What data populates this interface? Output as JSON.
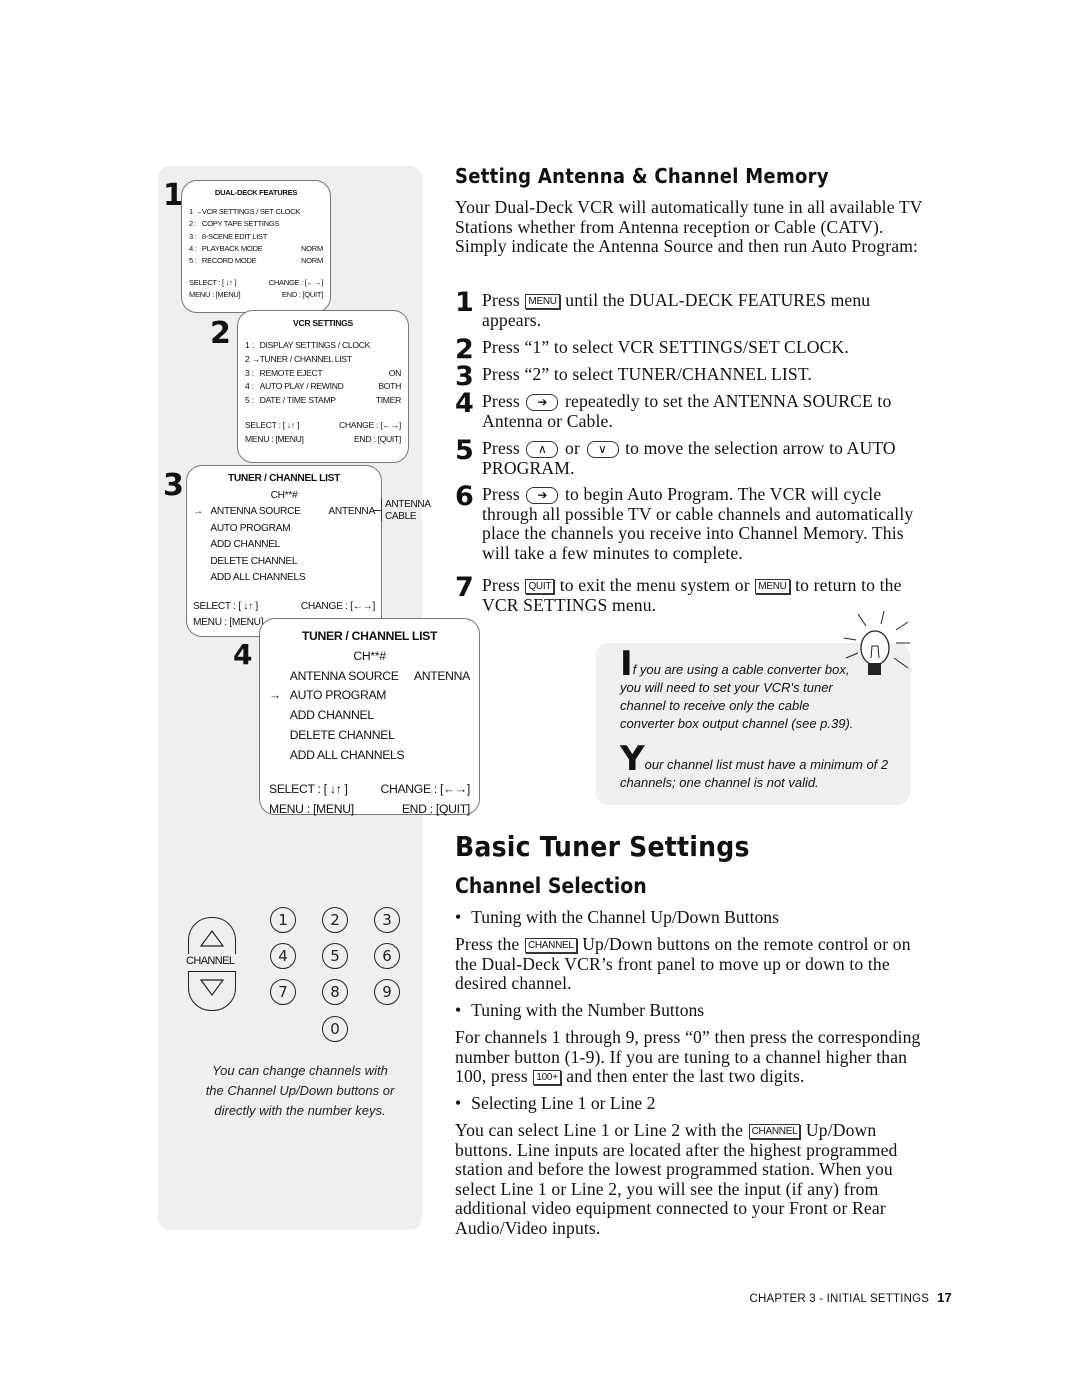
{
  "sidebar": {
    "screen1": {
      "step": "1",
      "title": "DUAL-DECK FEATURES",
      "rows": [
        {
          "n": "1 →",
          "l": "VCR SETTINGS / SET CLOCK",
          "v": ""
        },
        {
          "n": "2 :",
          "l": "COPY TAPE SETTINGS",
          "v": ""
        },
        {
          "n": "3 :",
          "l": "8-SCENE EDIT LIST",
          "v": ""
        },
        {
          "n": "4 :",
          "l": "PLAYBACK MODE",
          "v": "NORM"
        },
        {
          "n": "5 :",
          "l": "RECORD MODE",
          "v": "NORM"
        }
      ],
      "select": "SELECT : [ ↓↑ ]",
      "change": "CHANGE : [←→]",
      "menu": "MENU : [MENU]",
      "end": "END : [QUIT]"
    },
    "screen2": {
      "step": "2",
      "title": "VCR SETTINGS",
      "rows": [
        {
          "n": "1 :",
          "l": "DISPLAY SETTINGS / CLOCK",
          "v": ""
        },
        {
          "n": "2 →",
          "l": "TUNER / CHANNEL LIST",
          "v": ""
        },
        {
          "n": "3 :",
          "l": "REMOTE EJECT",
          "v": "ON"
        },
        {
          "n": "4 :",
          "l": "AUTO PLAY / REWIND",
          "v": "BOTH"
        },
        {
          "n": "5 :",
          "l": "DATE / TIME STAMP",
          "v": "TIMER"
        }
      ],
      "select": "SELECT : [ ↓↑ ]",
      "change": "CHANGE : [←→]",
      "menu": "MENU : [MENU]",
      "end": "END : [QUIT]"
    },
    "screen3": {
      "step": "3",
      "title": "TUNER / CHANNEL LIST",
      "ch": "CH**#",
      "rows": [
        {
          "n": "→",
          "l": "ANTENNA SOURCE",
          "v": "ANTENNA"
        },
        {
          "n": "",
          "l": "AUTO PROGRAM",
          "v": ""
        },
        {
          "n": "",
          "l": "ADD CHANNEL",
          "v": ""
        },
        {
          "n": "",
          "l": "DELETE CHANNEL",
          "v": ""
        },
        {
          "n": "",
          "l": "ADD ALL CHANNELS",
          "v": ""
        }
      ],
      "options": [
        "ANTENNA",
        "CABLE"
      ],
      "select": "SELECT : [ ↓↑ ]",
      "change": "CHANGE : [←→]",
      "menu": "MENU : [MENU]"
    },
    "screen4": {
      "step": "4",
      "title": "TUNER / CHANNEL LIST",
      "ch": "CH**#",
      "rows": [
        {
          "n": "",
          "l": "ANTENNA SOURCE",
          "v": "ANTENNA"
        },
        {
          "n": "→",
          "l": "AUTO PROGRAM",
          "v": ""
        },
        {
          "n": "",
          "l": "ADD CHANNEL",
          "v": ""
        },
        {
          "n": "",
          "l": "DELETE CHANNEL",
          "v": ""
        },
        {
          "n": "",
          "l": "ADD ALL CHANNELS",
          "v": ""
        }
      ],
      "select": "SELECT : [ ↓↑ ]",
      "change": "CHANGE : [←→]",
      "menu": "MENU : [MENU]",
      "end": "END : [QUIT]"
    },
    "remote": {
      "channel_label": "CHANNEL",
      "digits": [
        "1",
        "2",
        "3",
        "4",
        "5",
        "6",
        "7",
        "8",
        "9",
        "0"
      ]
    },
    "caption": [
      "You can change channels with",
      "the Channel Up/Down buttons or",
      "directly with the number keys."
    ]
  },
  "section1": {
    "heading": "Setting Antenna & Channel Memory",
    "intro": "Your Dual-Deck VCR will automatically tune in all available TV Stations whether from Antenna reception or Cable (CATV). Simply indicate the Antenna Source and then run Auto Program:",
    "steps": [
      {
        "n": "1",
        "parts": [
          {
            "t": "Press "
          },
          {
            "k": "MENU"
          },
          {
            "t": " until the DUAL-DECK FEATURES menu appears."
          }
        ]
      },
      {
        "n": "2",
        "parts": [
          {
            "t": "Press “1” to select VCR SETTINGS/SET CLOCK."
          }
        ]
      },
      {
        "n": "3",
        "parts": [
          {
            "t": "Press “2” to select TUNER/CHANNEL LIST."
          }
        ]
      },
      {
        "n": "4",
        "parts": [
          {
            "t": "Press "
          },
          {
            "r": "➔"
          },
          {
            "t": " repeatedly to set the ANTENNA SOURCE to Antenna or Cable."
          }
        ]
      },
      {
        "n": "5",
        "parts": [
          {
            "t": "Press "
          },
          {
            "r": "∧"
          },
          {
            "t": " or "
          },
          {
            "r": "∨"
          },
          {
            "t": " to move the selection arrow to AUTO PROGRAM."
          }
        ]
      },
      {
        "n": "6",
        "parts": [
          {
            "t": "Press "
          },
          {
            "r": "➔"
          },
          {
            "t": " to begin Auto Program. The VCR will cycle through all possible TV or cable channels and automatically place the channels you receive into Channel Memory. This will take a few minutes to complete."
          }
        ]
      },
      {
        "n": "7",
        "parts": [
          {
            "t": "Press "
          },
          {
            "k": "QUIT"
          },
          {
            "t": " to exit the menu system or "
          },
          {
            "k": "MENU"
          },
          {
            "t": " to return to the VCR SETTINGS menu."
          }
        ]
      }
    ],
    "tip": {
      "p1_initial": "I",
      "p1": "f you are using a cable converter box, you will need to set your VCR's tuner channel to receive only the cable converter box output channel (see p.39).",
      "p2_initial": "Y",
      "p2": "our channel list must have a minimum of 2 channels; one channel is not valid."
    }
  },
  "section2": {
    "title": "Basic Tuner Settings",
    "heading": "Channel Selection",
    "blocks": [
      {
        "bullet": "Tuning with the Channel Up/Down Buttons",
        "parts": [
          {
            "t": "Press the "
          },
          {
            "k": "CHANNEL"
          },
          {
            "t": " Up/Down buttons on the remote control or on the Dual-Deck VCR’s front panel to move up or down to the desired channel."
          }
        ]
      },
      {
        "bullet": "Tuning with the Number Buttons",
        "parts": [
          {
            "t": "For channels 1 through 9, press “0” then press the corresponding number button (1-9). If you are tuning to a channel higher than 100, press "
          },
          {
            "k": "100+"
          },
          {
            "t": " and then enter the last two digits."
          }
        ]
      },
      {
        "bullet": "Selecting Line 1 or Line 2",
        "parts": [
          {
            "t": "You can select Line 1 or Line 2 with the "
          },
          {
            "k": "CHANNEL"
          },
          {
            "t": " Up/Down buttons. Line inputs are located after the highest programmed station and before the lowest programmed station. When you select Line 1 or Line 2, you will see the input (if any) from additional video equipment connected to your Front or Rear Audio/Video inputs."
          }
        ]
      }
    ]
  },
  "footer": {
    "chapter": "CHAPTER 3 - INITIAL SETTINGS",
    "page": "17"
  }
}
